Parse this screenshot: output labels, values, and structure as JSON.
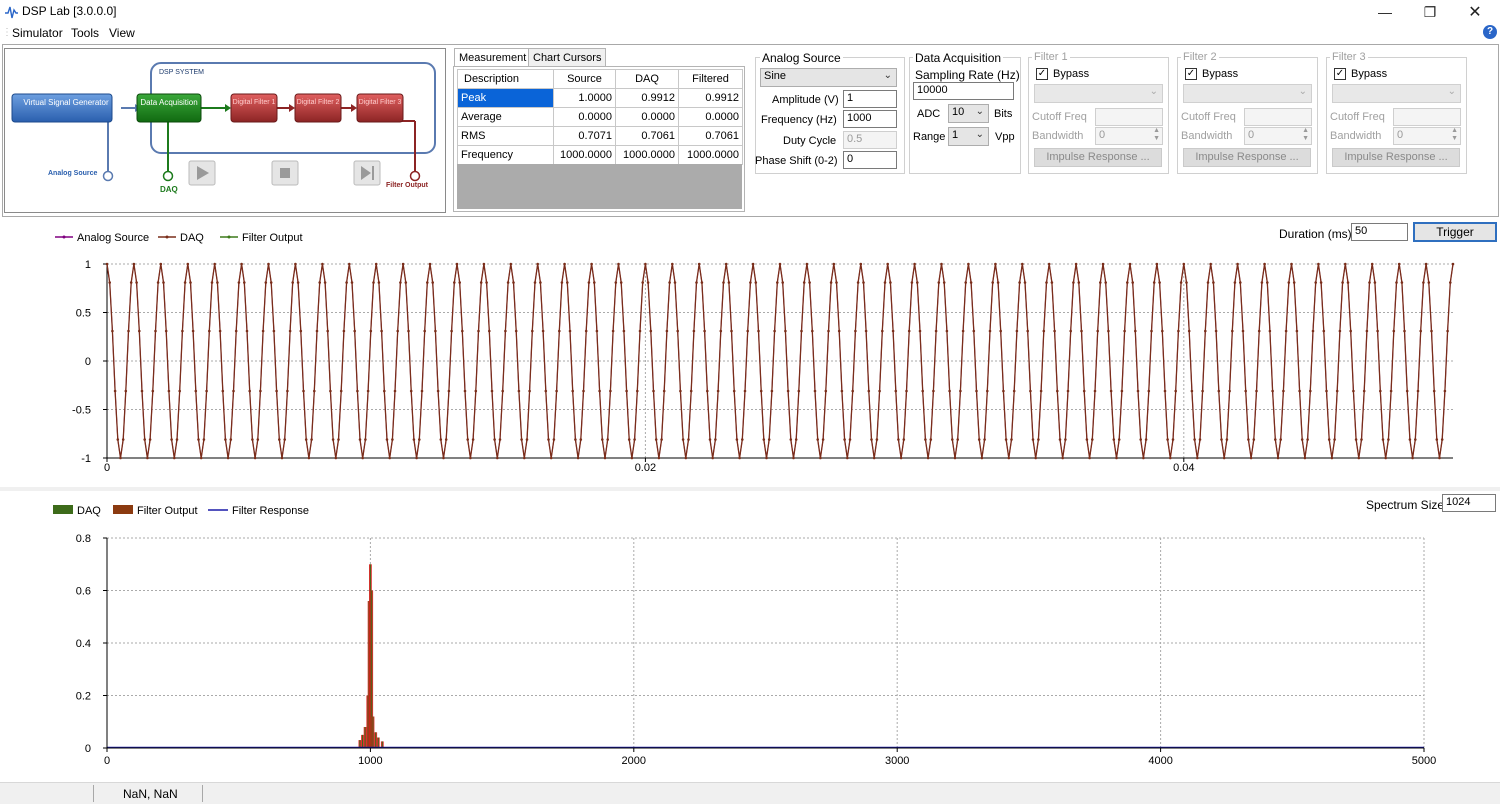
{
  "window": {
    "title": "DSP Lab [3.0.0.0]"
  },
  "menu": {
    "items": [
      "Simulator",
      "Tools",
      "View"
    ]
  },
  "diagram": {
    "system_label": "DSP SYSTEM",
    "generator": "Virtual Signal Generator",
    "daq_block": "Data Acquisition",
    "filter1": "Digital Filter 1",
    "filter2": "Digital Filter 2",
    "filter3": "Digital Filter 3",
    "analog_source_label": "Analog Source",
    "daq_label": "DAQ",
    "filter_output_label": "Filter Output"
  },
  "tabs": [
    {
      "label": "Measurement",
      "active": true
    },
    {
      "label": "Chart Cursors",
      "active": false
    }
  ],
  "measurement": {
    "headers": [
      "Description",
      "Source",
      "DAQ",
      "Filtered"
    ],
    "rows": [
      [
        "Peak",
        "1.0000",
        "0.9912",
        "0.9912"
      ],
      [
        "Average",
        "0.0000",
        "0.0000",
        "0.0000"
      ],
      [
        "RMS",
        "0.7071",
        "0.7061",
        "0.7061"
      ],
      [
        "Frequency",
        "1000.0000",
        "1000.0000",
        "1000.0000"
      ]
    ]
  },
  "analog_source": {
    "title": "Analog Source",
    "waveform": "Sine",
    "amplitude_label": "Amplitude (V)",
    "amplitude": "1",
    "frequency_label": "Frequency (Hz)",
    "frequency": "1000",
    "duty_label": "Duty Cycle",
    "duty": "0.5",
    "phase_label": "Phase Shift (0-2)",
    "phase": "0"
  },
  "daq": {
    "title": "Data Acquisition",
    "rate_label": "Sampling Rate (Hz)",
    "rate": "10000",
    "adc_label": "ADC",
    "adc": "10",
    "bits_label": "Bits",
    "range_label": "Range",
    "range": "1",
    "vpp_label": "Vpp"
  },
  "filters": [
    {
      "title": "Filter 1",
      "bypass_label": "Bypass",
      "cutoff_label": "Cutoff Freq",
      "bandwidth_label": "Bandwidth",
      "bandwidth": "0",
      "impulse_label": "Impulse Response ..."
    },
    {
      "title": "Filter 2",
      "bypass_label": "Bypass",
      "cutoff_label": "Cutoff Freq",
      "bandwidth_label": "Bandwidth",
      "bandwidth": "0",
      "impulse_label": "Impulse Response ..."
    },
    {
      "title": "Filter 3",
      "bypass_label": "Bypass",
      "cutoff_label": "Cutoff Freq",
      "bandwidth_label": "Bandwidth",
      "bandwidth": "0",
      "impulse_label": "Impulse Response ..."
    }
  ],
  "time_controls": {
    "duration_label": "Duration (ms)",
    "duration": "50",
    "trigger_label": "Trigger"
  },
  "spectrum_controls": {
    "size_label": "Spectrum Size",
    "size": "1024"
  },
  "status": {
    "text": "NaN, NaN"
  },
  "colors": {
    "source": "#800080",
    "daq": "#3d6b1a",
    "filtered": "#8b3a10",
    "response": "#1a1aa8",
    "selection": "#0a64d8"
  },
  "chart_data": [
    {
      "type": "line",
      "legend": [
        "Analog Source",
        "DAQ",
        "Filter Output"
      ],
      "series_colors": [
        "#800080",
        "#7a2e1a",
        "#3d7a1a"
      ],
      "signal": {
        "waveform": "sine",
        "amplitude": 1,
        "frequency_hz": 1000,
        "sampling_rate_hz": 10000,
        "duration_ms": 50
      },
      "xlim": [
        0,
        0.05
      ],
      "ylim": [
        -1,
        1
      ],
      "xticks": [
        "0",
        "0.02",
        "0.04"
      ],
      "yticks": [
        "1",
        "0.5",
        "0",
        "-0.5",
        "-1"
      ],
      "xtick_values": [
        0,
        0.02,
        0.04
      ],
      "ytick_values": [
        1,
        0.5,
        0,
        -0.5,
        -1
      ],
      "grid": true
    },
    {
      "type": "bar",
      "legend": [
        "DAQ",
        "Filter Output",
        "Filter Response"
      ],
      "series_colors": [
        "#3d6b1a",
        "#8b3a10",
        "#1a1aa8"
      ],
      "xlim": [
        0,
        5000
      ],
      "ylim": [
        0,
        0.8
      ],
      "xticks": [
        "0",
        "1000",
        "2000",
        "3000",
        "4000",
        "5000"
      ],
      "yticks": [
        "0.8",
        "0.6",
        "0.4",
        "0.2",
        "0"
      ],
      "xtick_values": [
        0,
        1000,
        2000,
        3000,
        4000,
        5000
      ],
      "ytick_values": [
        0.8,
        0.6,
        0.4,
        0.2,
        0
      ],
      "peaks": [
        {
          "x": 960,
          "y": 0.03
        },
        {
          "x": 970,
          "y": 0.05
        },
        {
          "x": 980,
          "y": 0.08
        },
        {
          "x": 990,
          "y": 0.2
        },
        {
          "x": 995,
          "y": 0.56
        },
        {
          "x": 1000,
          "y": 0.7
        },
        {
          "x": 1005,
          "y": 0.6
        },
        {
          "x": 1010,
          "y": 0.12
        },
        {
          "x": 1020,
          "y": 0.06
        },
        {
          "x": 1030,
          "y": 0.04
        },
        {
          "x": 1045,
          "y": 0.025
        }
      ],
      "grid": true
    }
  ]
}
